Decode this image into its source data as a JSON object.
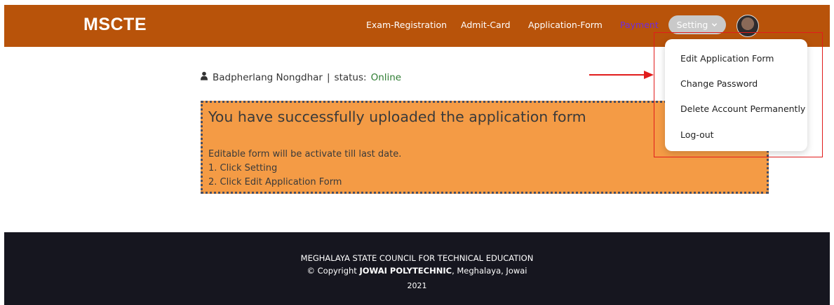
{
  "header": {
    "brand": "MSCTE",
    "nav": {
      "exam_registration": "Exam-Registration",
      "admit_card": "Admit-Card",
      "application_form": "Application-Form",
      "payment": "Payment",
      "setting": "Setting"
    }
  },
  "user": {
    "name": "Badpherlang Nongdhar",
    "separator": "|",
    "status_label": "status:",
    "status_value": "Online"
  },
  "message": {
    "title": "You have successfully uploaded the application form",
    "line1": "Editable form will be activate till last date.",
    "line2": "1. Click Setting",
    "line3": "2. Click Edit Application Form"
  },
  "dropdown": {
    "items": [
      "Edit Application Form",
      "Change Password",
      "Delete Account Permanently",
      "Log-out"
    ]
  },
  "footer": {
    "org": "MEGHALAYA STATE COUNCIL FOR TECHNICAL EDUCATION",
    "copyright_prefix": "© Copyright",
    "copyright_name": "JOWAI POLYTECHNIC",
    "copyright_suffix": ", Meghalaya, Jowai",
    "year": "2021"
  },
  "colors": {
    "header_bg": "#b8530a",
    "message_bg": "#f49b45",
    "footer_bg": "#16161f",
    "highlight": "#e11c1c",
    "status_online": "#2e7d32"
  },
  "icons": {
    "user": "user-icon",
    "setting_caret": "chevron-down-icon",
    "annotation": "red-arrow-icon"
  }
}
